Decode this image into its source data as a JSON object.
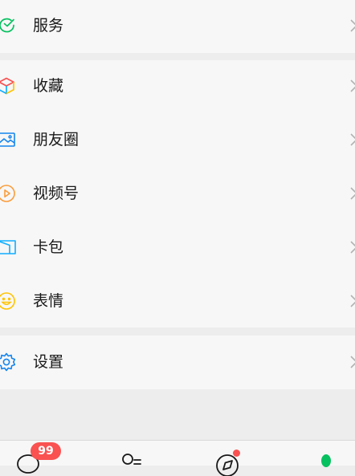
{
  "menu": {
    "items": [
      {
        "label": "服务",
        "icon": "service-icon",
        "color": "#07c160"
      },
      {
        "label": "收藏",
        "icon": "favorites-cube-icon",
        "color": "#fa5151"
      },
      {
        "label": "朋友圈",
        "icon": "moments-picture-icon",
        "color": "#1485ee"
      },
      {
        "label": "视频号",
        "icon": "channels-play-icon",
        "color": "#fa9d3b"
      },
      {
        "label": "卡包",
        "icon": "card-wallet-icon",
        "color": "#10aeff"
      },
      {
        "label": "表情",
        "icon": "sticker-smile-icon",
        "color": "#ffc300"
      },
      {
        "label": "设置",
        "icon": "settings-gear-icon",
        "color": "#1485ee"
      }
    ]
  },
  "tabbar": {
    "chats_badge": "99",
    "tabs": [
      "chats-icon",
      "contacts-icon",
      "discover-icon",
      "me-icon"
    ],
    "active_color": "#07c160",
    "badge_color": "#fa5151"
  }
}
